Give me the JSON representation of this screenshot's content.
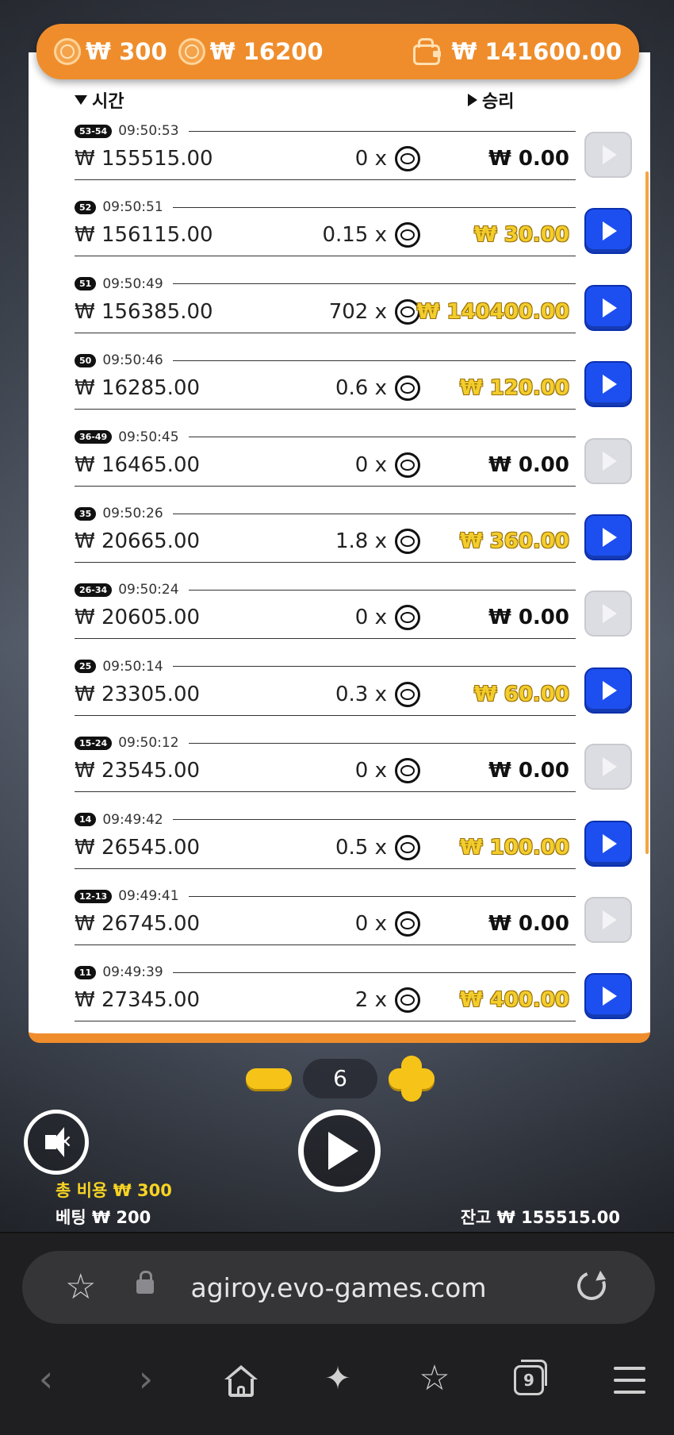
{
  "summary": {
    "bet_cost": "₩ 300",
    "max_win": "₩ 16200",
    "wallet_balance": "₩ 141600.00"
  },
  "history": {
    "col_time": "시간",
    "col_win": "승리",
    "rows": [
      {
        "badge": "53-54",
        "time": "09:50:53",
        "balance": "₩ 155515.00",
        "multiplier": "0 x",
        "win": "₩ 0.00",
        "win_type": "zero",
        "replay": "disabled"
      },
      {
        "badge": "52",
        "time": "09:50:51",
        "balance": "₩ 156115.00",
        "multiplier": "0.15 x",
        "win": "₩ 30.00",
        "win_type": "gold",
        "replay": "active"
      },
      {
        "badge": "51",
        "time": "09:50:49",
        "balance": "₩ 156385.00",
        "multiplier": "702 x",
        "win": "₩ 140400.00",
        "win_type": "gold",
        "replay": "active"
      },
      {
        "badge": "50",
        "time": "09:50:46",
        "balance": "₩ 16285.00",
        "multiplier": "0.6 x",
        "win": "₩ 120.00",
        "win_type": "gold",
        "replay": "active"
      },
      {
        "badge": "36-49",
        "time": "09:50:45",
        "balance": "₩ 16465.00",
        "multiplier": "0 x",
        "win": "₩ 0.00",
        "win_type": "zero",
        "replay": "disabled"
      },
      {
        "badge": "35",
        "time": "09:50:26",
        "balance": "₩ 20665.00",
        "multiplier": "1.8 x",
        "win": "₩ 360.00",
        "win_type": "gold",
        "replay": "active"
      },
      {
        "badge": "26-34",
        "time": "09:50:24",
        "balance": "₩ 20605.00",
        "multiplier": "0 x",
        "win": "₩ 0.00",
        "win_type": "zero",
        "replay": "disabled"
      },
      {
        "badge": "25",
        "time": "09:50:14",
        "balance": "₩ 23305.00",
        "multiplier": "0.3 x",
        "win": "₩ 60.00",
        "win_type": "gold",
        "replay": "active"
      },
      {
        "badge": "15-24",
        "time": "09:50:12",
        "balance": "₩ 23545.00",
        "multiplier": "0 x",
        "win": "₩ 0.00",
        "win_type": "zero",
        "replay": "disabled"
      },
      {
        "badge": "14",
        "time": "09:49:42",
        "balance": "₩ 26545.00",
        "multiplier": "0.5 x",
        "win": "₩ 100.00",
        "win_type": "gold",
        "replay": "active"
      },
      {
        "badge": "12-13",
        "time": "09:49:41",
        "balance": "₩ 26745.00",
        "multiplier": "0 x",
        "win": "₩ 0.00",
        "win_type": "zero",
        "replay": "disabled"
      },
      {
        "badge": "11",
        "time": "09:49:39",
        "balance": "₩ 27345.00",
        "multiplier": "2 x",
        "win": "₩ 400.00",
        "win_type": "gold",
        "replay": "active"
      }
    ]
  },
  "controls": {
    "bet_count": "6",
    "total_cost": "총 비용  ₩ 300",
    "betting": "베팅  ₩ 200",
    "balance": "잔고  ₩ 155515.00"
  },
  "browser": {
    "url": "agiroy.evo-games.com",
    "tab_count": "9"
  },
  "colors": {
    "accent_orange": "#ef8d2c",
    "win_gold": "#f3cd2c",
    "replay_blue": "#1d4ff0"
  }
}
